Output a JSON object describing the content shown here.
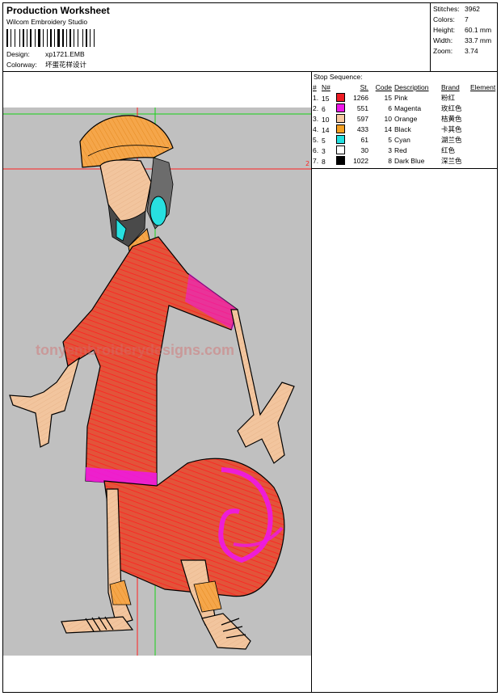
{
  "header": {
    "title": "Production Worksheet",
    "subtitle": "Wilcom Embroidery Studio",
    "design_label": "Design:",
    "design_value": "xp1721.EMB",
    "colorway_label": "Colorway:",
    "colorway_value": "坏蛋花样设计"
  },
  "stats": {
    "stitches_label": "Stitches:",
    "stitches_value": "3962",
    "colors_label": "Colors:",
    "colors_value": "7",
    "height_label": "Height:",
    "height_value": "60.1 mm",
    "width_label": "Width:",
    "width_value": "33.7 mm",
    "zoom_label": "Zoom:",
    "zoom_value": "3.74"
  },
  "stop_sequence": {
    "title": "Stop Sequence:",
    "columns": [
      "#",
      "N#",
      "St.",
      "Code",
      "Description",
      "Brand",
      "Element"
    ],
    "rows": [
      {
        "idx": "1.",
        "n": "15",
        "color": "#ee1c24",
        "st": "1266",
        "code": "15",
        "desc": "Pink",
        "brand": "粉红"
      },
      {
        "idx": "2.",
        "n": "6",
        "color": "#ee18e8",
        "st": "551",
        "code": "6",
        "desc": "Magenta",
        "brand": "玫红色"
      },
      {
        "idx": "3.",
        "n": "10",
        "color": "#f7c9a0",
        "st": "597",
        "code": "10",
        "desc": "Orange",
        "brand": "桔黄色"
      },
      {
        "idx": "4.",
        "n": "14",
        "color": "#f5a020",
        "st": "433",
        "code": "14",
        "desc": "Black",
        "brand": "卡其色"
      },
      {
        "idx": "5.",
        "n": "5",
        "color": "#22e0e0",
        "st": "61",
        "code": "5",
        "desc": "Cyan",
        "brand": "湖兰色"
      },
      {
        "idx": "6.",
        "n": "3",
        "color": "#ffffff",
        "st": "30",
        "code": "3",
        "desc": "Red",
        "brand": "红色"
      },
      {
        "idx": "7.",
        "n": "8",
        "color": "#000000",
        "st": "1022",
        "code": "8",
        "desc": "Dark Blue",
        "brand": "深兰色"
      }
    ]
  },
  "canvas": {
    "marker": "2",
    "watermark": "tonyembroiderydesigns.com"
  }
}
